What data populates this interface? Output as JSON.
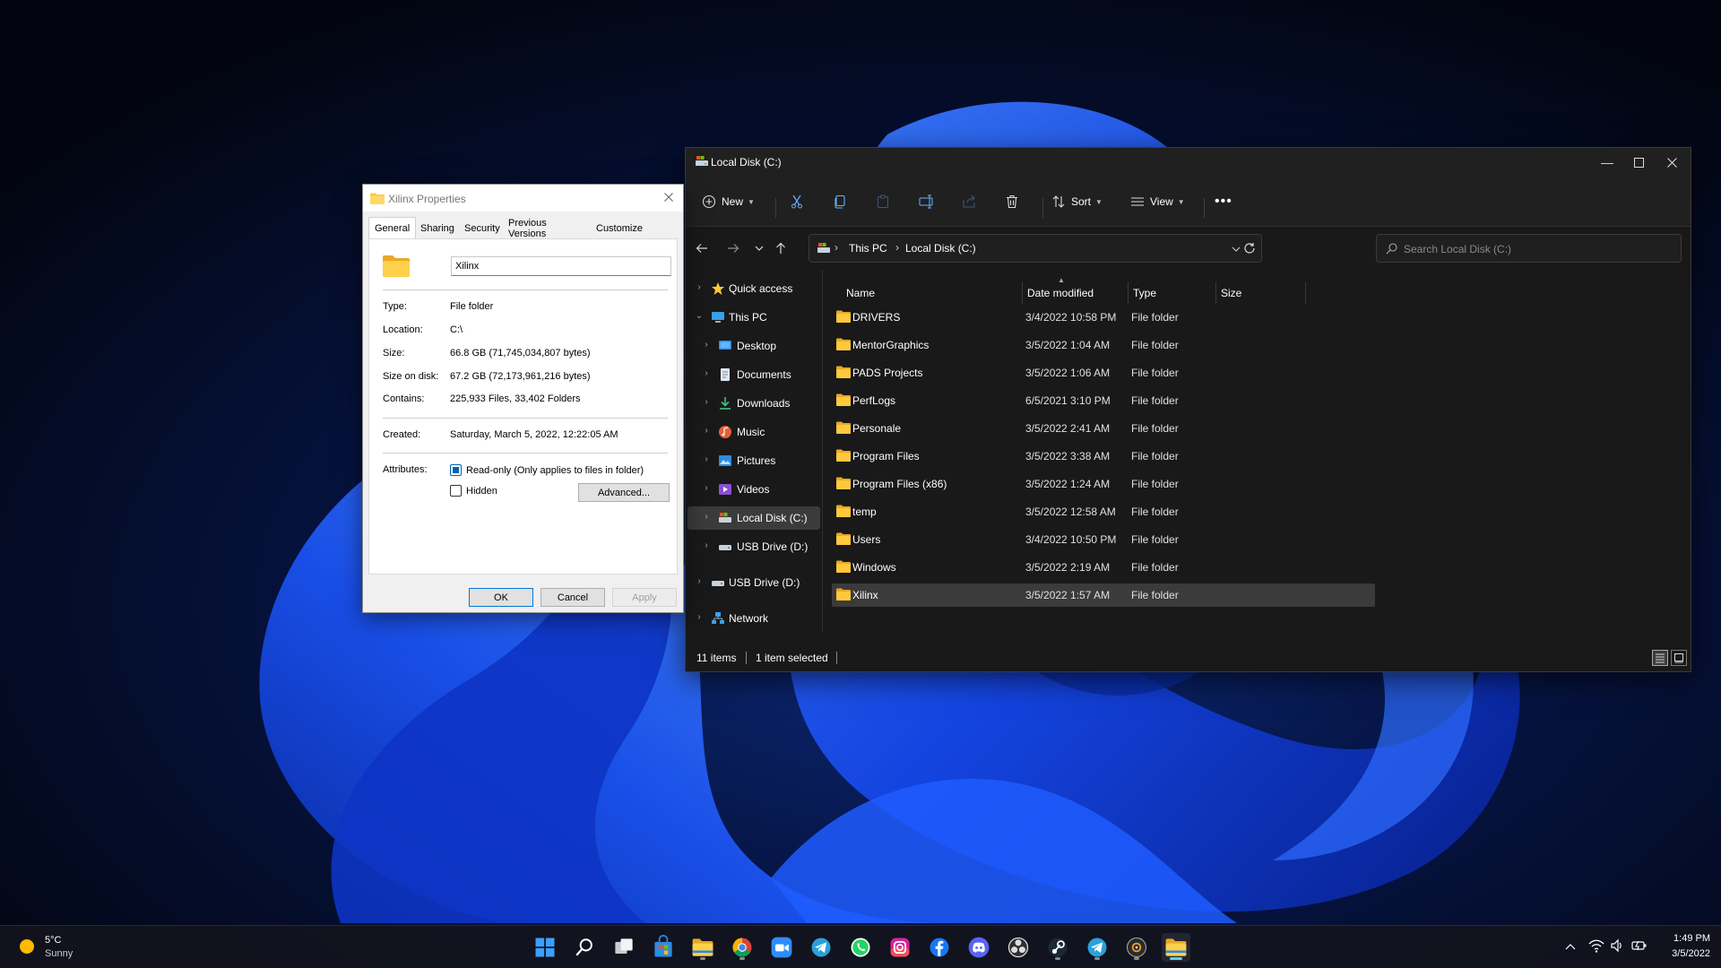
{
  "colors": {
    "wallpaper_blue": "#1d5cf0",
    "accent": "#0078d7",
    "folder_yellow": "#ffc83d"
  },
  "explorer": {
    "title": "Local Disk (C:)",
    "toolbar": {
      "new_label": "New",
      "sort_label": "Sort",
      "view_label": "View"
    },
    "address": {
      "crumbs": [
        "This PC",
        "Local Disk (C:)"
      ]
    },
    "search": {
      "placeholder": "Search Local Disk (C:)"
    },
    "nav": [
      {
        "label": "Quick access",
        "icon": "star-icon"
      },
      {
        "label": "This PC",
        "icon": "computer-icon"
      },
      {
        "label": "Desktop",
        "icon": "desktop-icon"
      },
      {
        "label": "Documents",
        "icon": "documents-icon"
      },
      {
        "label": "Downloads",
        "icon": "downloads-icon"
      },
      {
        "label": "Music",
        "icon": "music-icon"
      },
      {
        "label": "Pictures",
        "icon": "pictures-icon"
      },
      {
        "label": "Videos",
        "icon": "videos-icon"
      },
      {
        "label": "Local Disk (C:)",
        "icon": "local-disk-icon",
        "selected": true
      },
      {
        "label": "USB Drive (D:)",
        "icon": "usb-drive-icon"
      },
      {
        "label": "USB Drive (D:)",
        "icon": "usb-drive-icon"
      },
      {
        "label": "Network",
        "icon": "network-icon"
      }
    ],
    "columns": {
      "name": "Name",
      "date": "Date modified",
      "type": "Type",
      "size": "Size"
    },
    "files": [
      {
        "name": "DRIVERS",
        "date": "3/4/2022 10:58 PM",
        "type": "File folder"
      },
      {
        "name": "MentorGraphics",
        "date": "3/5/2022 1:04 AM",
        "type": "File folder"
      },
      {
        "name": "PADS Projects",
        "date": "3/5/2022 1:06 AM",
        "type": "File folder"
      },
      {
        "name": "PerfLogs",
        "date": "6/5/2021 3:10 PM",
        "type": "File folder"
      },
      {
        "name": "Personale",
        "date": "3/5/2022 2:41 AM",
        "type": "File folder"
      },
      {
        "name": "Program Files",
        "date": "3/5/2022 3:38 AM",
        "type": "File folder"
      },
      {
        "name": "Program Files (x86)",
        "date": "3/5/2022 1:24 AM",
        "type": "File folder"
      },
      {
        "name": "temp",
        "date": "3/5/2022 12:58 AM",
        "type": "File folder"
      },
      {
        "name": "Users",
        "date": "3/4/2022 10:50 PM",
        "type": "File folder"
      },
      {
        "name": "Windows",
        "date": "3/5/2022 2:19 AM",
        "type": "File folder"
      },
      {
        "name": "Xilinx",
        "date": "3/5/2022 1:57 AM",
        "type": "File folder",
        "selected": true
      }
    ],
    "status": {
      "items": "11 items",
      "selected": "1 item selected"
    }
  },
  "props": {
    "title": "Xilinx Properties",
    "tabs": [
      "General",
      "Sharing",
      "Security",
      "Previous Versions",
      "Customize"
    ],
    "name_value": "Xilinx",
    "rows": [
      {
        "label": "Type:",
        "value": "File folder"
      },
      {
        "label": "Location:",
        "value": "C:\\"
      },
      {
        "label": "Size:",
        "value": "66.8 GB (71,745,034,807 bytes)"
      },
      {
        "label": "Size on disk:",
        "value": "67.2 GB (72,173,961,216 bytes)"
      },
      {
        "label": "Contains:",
        "value": "225,933 Files, 33,402 Folders"
      },
      {
        "label": "Created:",
        "value": "Saturday, March 5, 2022, 12:22:05 AM"
      }
    ],
    "attributes_label": "Attributes:",
    "readonly_label": "Read-only (Only applies to files in folder)",
    "hidden_label": "Hidden",
    "advanced_label": "Advanced...",
    "ok_label": "OK",
    "cancel_label": "Cancel",
    "apply_label": "Apply"
  },
  "taskbar": {
    "weather_temp": "5°C",
    "weather_desc": "Sunny",
    "time": "1:49 PM",
    "date": "3/5/2022",
    "apps": [
      "start-icon",
      "search-icon",
      "task-view-icon",
      "store-icon",
      "file-explorer-icon",
      "chrome-icon",
      "zoom-icon",
      "telegram-icon",
      "whatsapp-icon",
      "instagram-icon",
      "facebook-icon",
      "discord-icon",
      "obs-icon",
      "steam-icon",
      "telegram-icon",
      "media-player-icon",
      "file-explorer-icon"
    ]
  }
}
